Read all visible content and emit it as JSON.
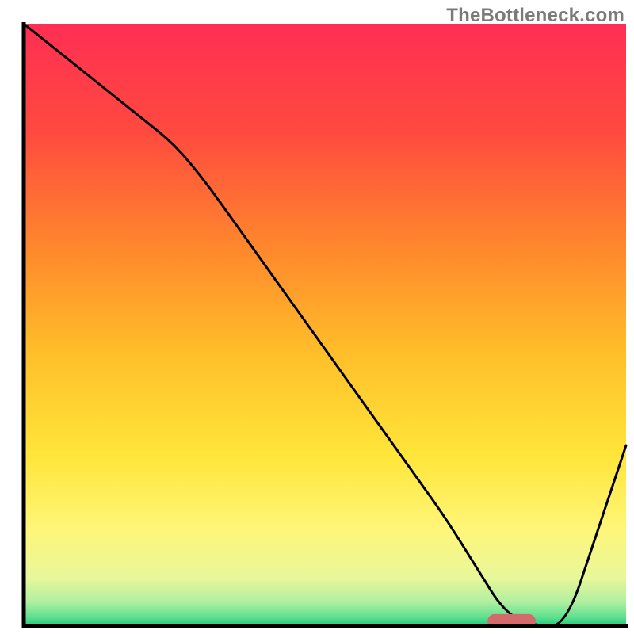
{
  "watermark": "TheBottleneck.com",
  "chart_data": {
    "type": "line",
    "title": "",
    "xlabel": "",
    "ylabel": "",
    "xlim": [
      0,
      100
    ],
    "ylim": [
      0,
      100
    ],
    "x": [
      0,
      5,
      10,
      15,
      20,
      25,
      30,
      35,
      40,
      45,
      50,
      55,
      60,
      65,
      70,
      75,
      80,
      85,
      90,
      95,
      100
    ],
    "values": [
      100,
      96,
      92,
      88,
      84,
      80,
      74,
      67,
      60,
      53,
      46,
      39,
      32,
      25,
      18,
      10,
      2,
      0,
      0,
      15,
      30
    ],
    "marker": {
      "x_start": 77,
      "x_end": 85,
      "y": 0.8
    },
    "gradient_stops": [
      {
        "offset": 0.0,
        "color": "#ff2e54"
      },
      {
        "offset": 0.18,
        "color": "#ff4a3f"
      },
      {
        "offset": 0.38,
        "color": "#ff8a2c"
      },
      {
        "offset": 0.55,
        "color": "#ffbf2a"
      },
      {
        "offset": 0.72,
        "color": "#ffe63a"
      },
      {
        "offset": 0.84,
        "color": "#fff67a"
      },
      {
        "offset": 0.92,
        "color": "#e8f79a"
      },
      {
        "offset": 0.96,
        "color": "#b0efa0"
      },
      {
        "offset": 0.985,
        "color": "#5fe090"
      },
      {
        "offset": 1.0,
        "color": "#1fc97a"
      }
    ],
    "axis_color": "#000000",
    "line_color": "#000000",
    "marker_color": "#d46a6a"
  }
}
